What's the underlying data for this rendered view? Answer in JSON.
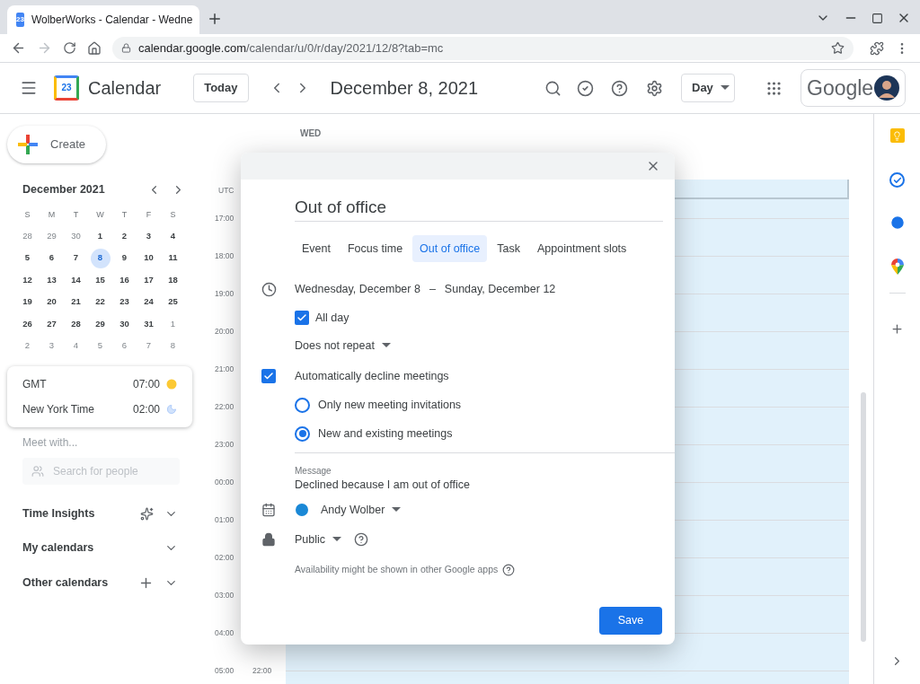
{
  "browser": {
    "tab": {
      "favicon_text": "23",
      "title": "WolberWorks - Calendar - Wedne"
    },
    "url": {
      "host": "calendar.google.com",
      "path": "/calendar/u/0/r/day/2021/12/8?tab=mc"
    }
  },
  "header": {
    "logo_text": "23",
    "app_title": "Calendar",
    "today_button": "Today",
    "date": "December 8, 2021",
    "view": "Day",
    "brand": "Google"
  },
  "sidebar": {
    "create_button": "Create",
    "mini_calendar": {
      "month": "December 2021",
      "weekdays": [
        "S",
        "M",
        "T",
        "W",
        "T",
        "F",
        "S"
      ],
      "weeks": [
        [
          {
            "day": "28",
            "in_month": false,
            "selected": false
          },
          {
            "day": "29",
            "in_month": false,
            "selected": false
          },
          {
            "day": "30",
            "in_month": false,
            "selected": false
          },
          {
            "day": "1",
            "in_month": true,
            "selected": false
          },
          {
            "day": "2",
            "in_month": true,
            "selected": false
          },
          {
            "day": "3",
            "in_month": true,
            "selected": false
          },
          {
            "day": "4",
            "in_month": true,
            "selected": false
          }
        ],
        [
          {
            "day": "5",
            "in_month": true,
            "selected": false
          },
          {
            "day": "6",
            "in_month": true,
            "selected": false
          },
          {
            "day": "7",
            "in_month": true,
            "selected": false
          },
          {
            "day": "8",
            "in_month": true,
            "selected": true
          },
          {
            "day": "9",
            "in_month": true,
            "selected": false
          },
          {
            "day": "10",
            "in_month": true,
            "selected": false
          },
          {
            "day": "11",
            "in_month": true,
            "selected": false
          }
        ],
        [
          {
            "day": "12",
            "in_month": true,
            "selected": false
          },
          {
            "day": "13",
            "in_month": true,
            "selected": false
          },
          {
            "day": "14",
            "in_month": true,
            "selected": false
          },
          {
            "day": "15",
            "in_month": true,
            "selected": false
          },
          {
            "day": "16",
            "in_month": true,
            "selected": false
          },
          {
            "day": "17",
            "in_month": true,
            "selected": false
          },
          {
            "day": "18",
            "in_month": true,
            "selected": false
          }
        ],
        [
          {
            "day": "19",
            "in_month": true,
            "selected": false
          },
          {
            "day": "20",
            "in_month": true,
            "selected": false
          },
          {
            "day": "21",
            "in_month": true,
            "selected": false
          },
          {
            "day": "22",
            "in_month": true,
            "selected": false
          },
          {
            "day": "23",
            "in_month": true,
            "selected": false
          },
          {
            "day": "24",
            "in_month": true,
            "selected": false
          },
          {
            "day": "25",
            "in_month": true,
            "selected": false
          }
        ],
        [
          {
            "day": "26",
            "in_month": true,
            "selected": false
          },
          {
            "day": "27",
            "in_month": true,
            "selected": false
          },
          {
            "day": "28",
            "in_month": true,
            "selected": false
          },
          {
            "day": "29",
            "in_month": true,
            "selected": false
          },
          {
            "day": "30",
            "in_month": true,
            "selected": false
          },
          {
            "day": "31",
            "in_month": true,
            "selected": false
          },
          {
            "day": "1",
            "in_month": false,
            "selected": false
          }
        ],
        [
          {
            "day": "2",
            "in_month": false,
            "selected": false
          },
          {
            "day": "3",
            "in_month": false,
            "selected": false
          },
          {
            "day": "4",
            "in_month": false,
            "selected": false
          },
          {
            "day": "5",
            "in_month": false,
            "selected": false
          },
          {
            "day": "6",
            "in_month": false,
            "selected": false
          },
          {
            "day": "7",
            "in_month": false,
            "selected": false
          },
          {
            "day": "8",
            "in_month": false,
            "selected": false
          }
        ]
      ]
    },
    "world_clock": [
      {
        "zone": "GMT",
        "time": "07:00",
        "kind": "day"
      },
      {
        "zone": "New York Time",
        "time": "02:00",
        "kind": "night"
      }
    ],
    "meet_with": "Meet with...",
    "search_placeholder": "Search for people",
    "sections": [
      {
        "label": "Time Insights",
        "kind": "insights"
      },
      {
        "label": "My calendars",
        "kind": "plain"
      },
      {
        "label": "Other calendars",
        "kind": "add"
      }
    ]
  },
  "timeline": {
    "day_label": "WED",
    "timezone": "UTC",
    "hours": [
      {
        "time": "17:00"
      },
      {
        "time": "18:00"
      },
      {
        "time": "19:00"
      },
      {
        "time": "20:00"
      },
      {
        "time": "21:00"
      },
      {
        "time": "22:00"
      },
      {
        "time": "23:00"
      },
      {
        "time": "00:00"
      },
      {
        "time": "01:00"
      },
      {
        "time": "02:00"
      },
      {
        "time": "03:00"
      },
      {
        "time": "04:00"
      },
      {
        "time": "05:00",
        "second_time": "22:00"
      }
    ]
  },
  "dialog": {
    "title": "Out of office",
    "tabs": [
      {
        "label": "Event",
        "selected": false
      },
      {
        "label": "Focus time",
        "selected": false
      },
      {
        "label": "Out of office",
        "selected": true
      },
      {
        "label": "Task",
        "selected": false
      },
      {
        "label": "Appointment slots",
        "selected": false
      }
    ],
    "date_range": {
      "start": "Wednesday, December 8",
      "separator": "–",
      "end": "Sunday, December 12"
    },
    "all_day": {
      "label": "All day",
      "checked": true
    },
    "repeat": "Does not repeat",
    "decline": {
      "label": "Automatically decline meetings",
      "checked": true
    },
    "options": [
      {
        "label": "Only new meeting invitations",
        "selected": false
      },
      {
        "label": "New and existing meetings",
        "selected": true
      }
    ],
    "message": {
      "label": "Message",
      "value": "Declined because I am out of office"
    },
    "calendar": {
      "name": "Andy Wolber",
      "color": "#1a88d6"
    },
    "visibility": "Public",
    "availability_note": "Availability might be shown in other Google apps",
    "save_button": "Save"
  }
}
